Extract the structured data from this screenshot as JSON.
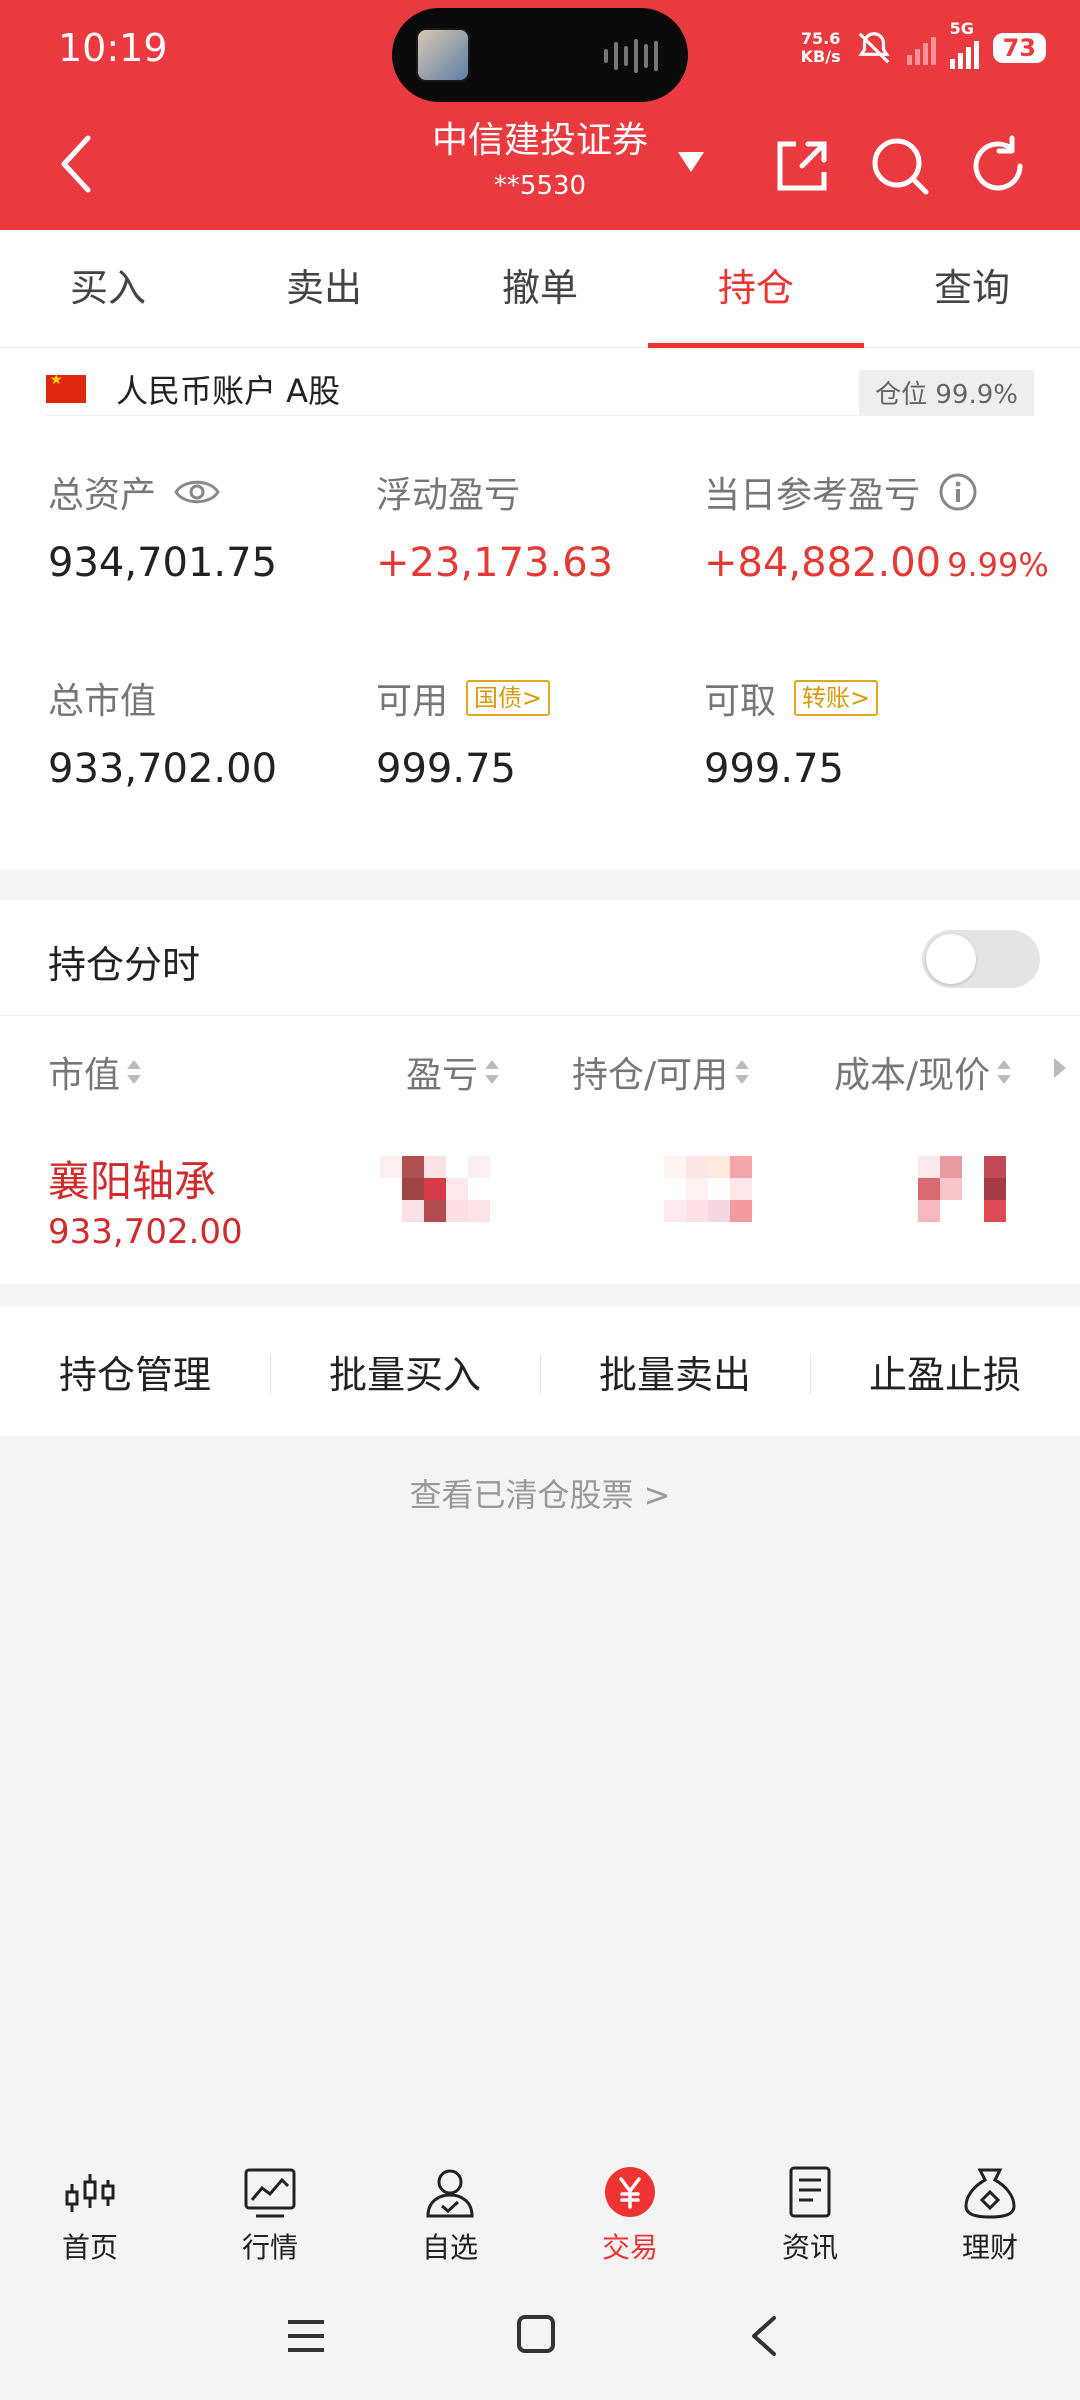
{
  "status_bar": {
    "time": "10:19",
    "net_speed_value": "75.6",
    "net_speed_unit": "KB/s",
    "network": "5G",
    "battery": "73"
  },
  "header": {
    "broker": "中信建投证券",
    "account": "**5530",
    "icons": [
      "back-icon",
      "caret-down-icon",
      "share-icon",
      "search-icon",
      "refresh-icon"
    ]
  },
  "tabs": [
    {
      "label": "买入",
      "active": false
    },
    {
      "label": "卖出",
      "active": false
    },
    {
      "label": "撤单",
      "active": false
    },
    {
      "label": "持仓",
      "active": true
    },
    {
      "label": "查询",
      "active": false
    }
  ],
  "account": {
    "label": "人民币账户 A股",
    "position_badge": "仓位 99.9%",
    "total_assets_label": "总资产",
    "total_assets": "934,701.75",
    "floating_pl_label": "浮动盈亏",
    "floating_pl": "+23,173.63",
    "daily_pl_label": "当日参考盈亏",
    "daily_pl": "+84,882.00",
    "daily_pl_pct": "9.99%",
    "market_value_label": "总市值",
    "market_value": "933,702.00",
    "available_label": "可用",
    "available_tag": "国债>",
    "available": "999.75",
    "withdrawable_label": "可取",
    "withdrawable_tag": "转账>",
    "withdrawable": "999.75"
  },
  "position_timing": {
    "label": "持仓分时",
    "enabled": false
  },
  "holdings": {
    "columns": [
      "市值",
      "盈亏",
      "持仓/可用",
      "成本/现价"
    ],
    "rows": [
      {
        "name": "襄阳轴承",
        "market_value": "933,702.00"
      }
    ]
  },
  "actions": [
    "持仓管理",
    "批量买入",
    "批量卖出",
    "止盈止损"
  ],
  "cleared_link": "查看已清仓股票 >",
  "bottom_nav": [
    {
      "label": "首页",
      "icon": "candlestick-icon",
      "active": false
    },
    {
      "label": "行情",
      "icon": "chart-icon",
      "active": false
    },
    {
      "label": "自选",
      "icon": "user-check-icon",
      "active": false
    },
    {
      "label": "交易",
      "icon": "yuan-icon",
      "active": true
    },
    {
      "label": "资讯",
      "icon": "news-icon",
      "active": false
    },
    {
      "label": "理财",
      "icon": "money-bag-icon",
      "active": false
    }
  ],
  "colors": {
    "brand_red": "#ea3a3f",
    "profit_red": "#e53935",
    "tag_gold": "#e0a820"
  }
}
